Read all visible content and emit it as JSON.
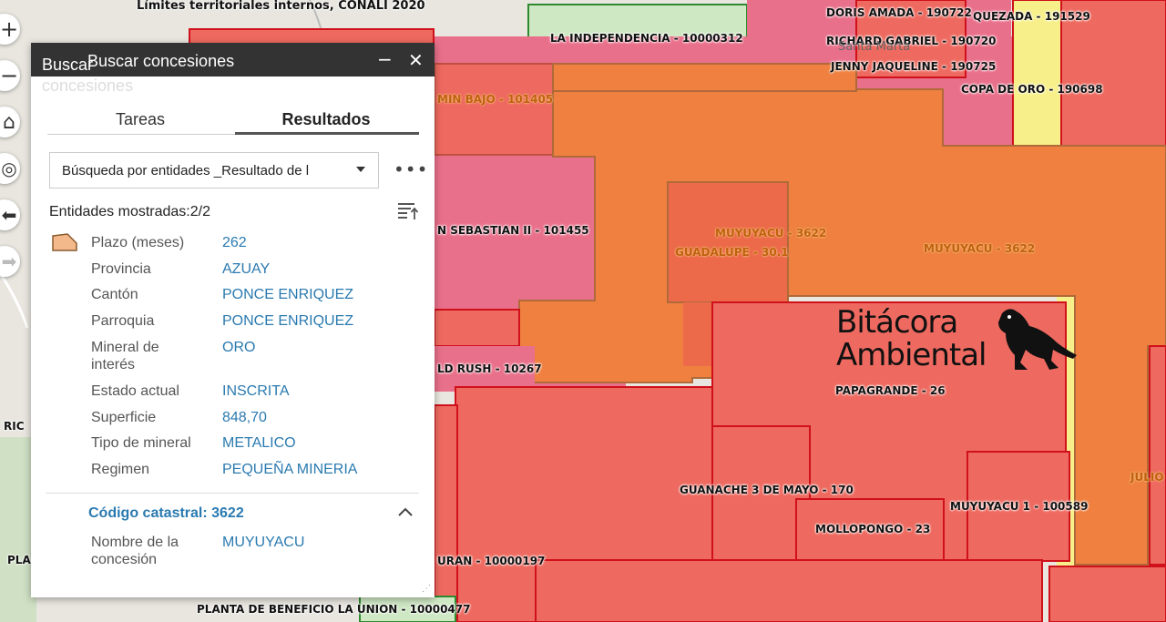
{
  "map": {
    "top_title": "Límites territoriales internos, CONALI 2020",
    "concession_labels": [
      "DORIS AMADA - 190722",
      "QUEZADA - 191529",
      "LA INDEPENDENCIA - 10000312",
      "RICHARD GABRIEL - 190720",
      "JENNY JAQUELINE - 190725",
      "COPA DE ORO - 190698",
      "MIN BAJO - 101405",
      "N SEBASTIAN II - 101455",
      "MUYUYACU - 3622",
      "GUADALUPE - 30.1",
      "MUYUYACU - 3622",
      "LD RUSH - 10267",
      "PAPAGRANDE - 26",
      "GUANACHE 3 DE MAYO - 170",
      "MUYUYACU 1 - 100589",
      "MOLLOPONGO - 23",
      "URAN  - 10000197",
      "PLANTA DE BENEFICIO LA UNION - 10000477",
      "JULIO"
    ],
    "place_labels": [
      "Santa Marta",
      "RIC",
      "PLA"
    ],
    "colors": {
      "basemap": "#e8e6df",
      "concession_red": "#ee6a60",
      "concession_orange": "#ef8040",
      "concession_pink": "#e9708b",
      "green_area": "#cfe8c4",
      "yellow_area": "#f7f08a"
    }
  },
  "zoom_controls": [
    {
      "icon": "plus-icon",
      "glyph": "+"
    },
    {
      "icon": "minus-icon",
      "glyph": "−"
    },
    {
      "icon": "home-icon",
      "glyph": "⌂"
    },
    {
      "icon": "locate-icon",
      "glyph": "◎"
    },
    {
      "icon": "back-arrow-icon",
      "glyph": "⬅"
    },
    {
      "icon": "forward-arrow-icon",
      "glyph": "➡"
    }
  ],
  "logo": {
    "line1": "Bitácora",
    "line2": "Ambiental",
    "icon": "iguana-icon"
  },
  "panel": {
    "title": "Buscar concesiones",
    "ghost_title_a": "Buscar",
    "ghost_title_b": "concesiones",
    "minimize_glyph": "−",
    "close_glyph": "✕",
    "tabs": [
      {
        "label": "Tareas",
        "active": false
      },
      {
        "label": "Resultados",
        "active": true
      }
    ],
    "select_value": "Búsqueda por entidades _Resultado de l",
    "more_glyph": "•••",
    "entities_count": "Entidades mostradas:2/2",
    "attributes": [
      {
        "label": "Plazo (meses)",
        "value": "262"
      },
      {
        "label": "Provincia",
        "value": "AZUAY"
      },
      {
        "label": "Cantón",
        "value": "PONCE ENRIQUEZ"
      },
      {
        "label": "Parroquia",
        "value": "PONCE ENRIQUEZ"
      },
      {
        "label": "Mineral de interés",
        "value": "ORO"
      },
      {
        "label": "Estado actual",
        "value": "INSCRITA"
      },
      {
        "label": "Superficie",
        "value": "848,70"
      },
      {
        "label": "Tipo de mineral",
        "value": "METALICO"
      },
      {
        "label": "Regimen",
        "value": "PEQUEÑA MINERIA"
      }
    ],
    "code_title": "Código catastral: 3622",
    "code_attributes": [
      {
        "label": "Nombre de la concesión",
        "value": "MUYUYACU"
      }
    ],
    "accent_color": "#2a7ab0"
  }
}
